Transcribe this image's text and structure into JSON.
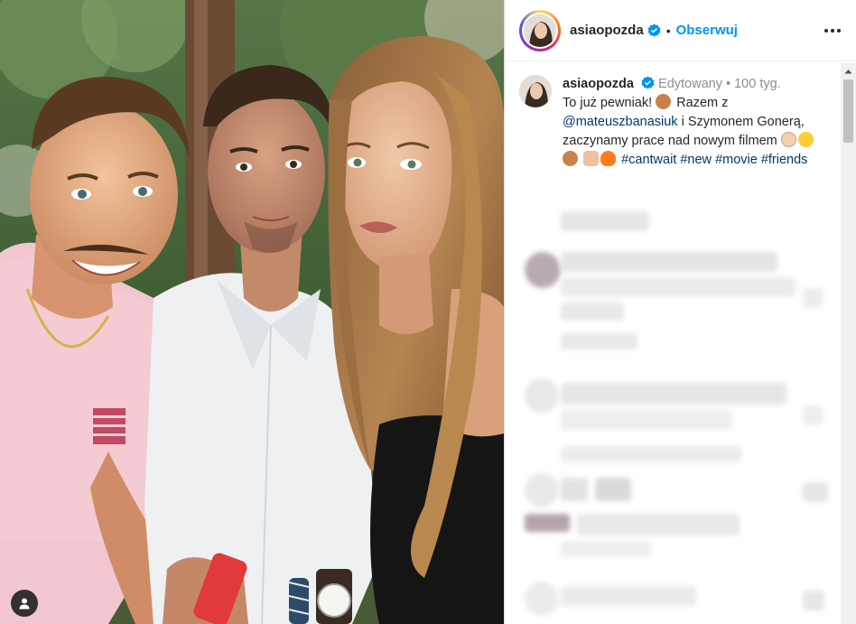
{
  "post": {
    "username": "asiaopozda",
    "separator": "•",
    "follow_label": "Obserwuj"
  },
  "caption": {
    "username": "asiaopozda",
    "edited": "Edytowany",
    "dot": "•",
    "age": "100 tyg.",
    "line1": "To już pewniak!",
    "razem": "Razem z",
    "mention": "@mateuszbanasiuk",
    "after_mention": "i Szymonem Gonerą, zaczynamy prace nad nowym filmem",
    "hashtag1": "#cantwait",
    "hashtag2": "#new",
    "hashtag3": "#movie",
    "hashtag4": "#friends"
  },
  "icons": {
    "verified": "verified-badge-icon",
    "more": "more-options-icon",
    "tag": "user-tag-icon",
    "scroll_up": "scroll-up-arrow-icon"
  },
  "colors": {
    "link": "#00376b",
    "follow": "#0095f6",
    "verified": "#0095f6",
    "meta": "#8e8e8e"
  }
}
